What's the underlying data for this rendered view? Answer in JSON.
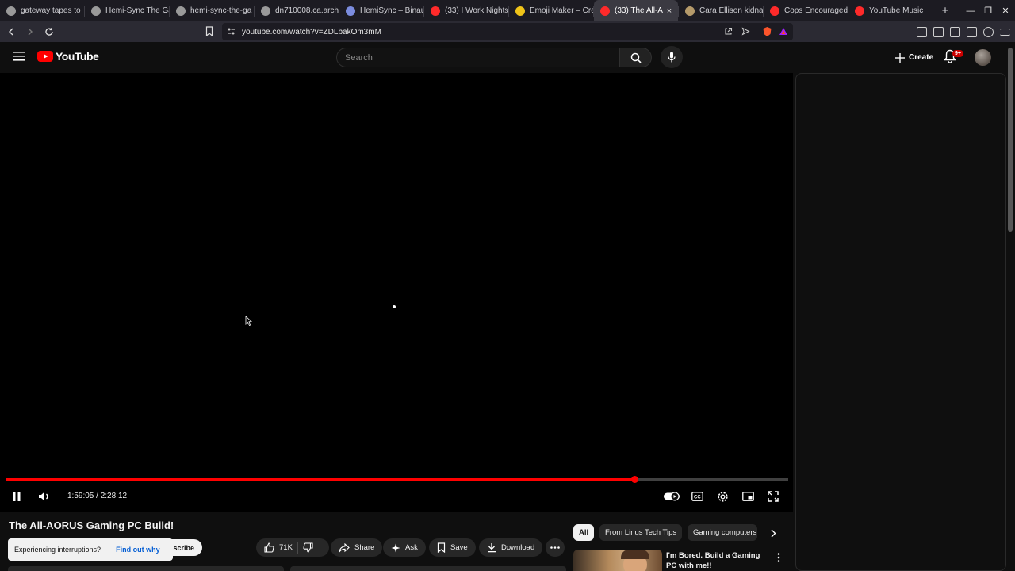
{
  "browser": {
    "tabs": [
      {
        "title": "gateway tapes to",
        "color": "#9a9a9a",
        "active": false
      },
      {
        "title": "Hemi-Sync The Ga",
        "color": "#9a9a9a",
        "active": false
      },
      {
        "title": "hemi-sync-the-ga",
        "color": "#9a9a9a",
        "active": false
      },
      {
        "title": "dn710008.ca.arch",
        "color": "#9a9a9a",
        "active": false
      },
      {
        "title": "HemiSync – Binau",
        "color": "#7b8cde",
        "active": false
      },
      {
        "title": "(33) I Work Nights",
        "color": "#ff2a2a",
        "active": false
      },
      {
        "title": "Emoji Maker – Cre",
        "color": "#f0c419",
        "active": false
      },
      {
        "title": "(33) The All-A",
        "color": "#ff2a2a",
        "active": true
      },
      {
        "title": "Cara Ellison kidna",
        "color": "#b59a6a",
        "active": false
      },
      {
        "title": "Cops Encouraged",
        "color": "#ff2a2a",
        "active": false
      },
      {
        "title": "YouTube Music",
        "color": "#ff2a2a",
        "active": false
      }
    ],
    "tab_close": "×",
    "new_tab": "+",
    "url": "youtube.com/watch?v=ZDLbakOm3mM"
  },
  "youtube": {
    "logo_text": "YouTube",
    "search_placeholder": "Search",
    "create_label": "Create",
    "notification_badge": "9+"
  },
  "player": {
    "current_time": "1:59:05",
    "duration": "2:28:12",
    "time_display": "1:59:05 / 2:28:12",
    "progress_fraction": 0.8037
  },
  "video": {
    "title": "The All-AORUS Gaming PC Build!",
    "subscribe_label": "scribe",
    "likes": "71K",
    "share_label": "Share",
    "ask_label": "Ask",
    "save_label": "Save",
    "download_label": "Download"
  },
  "toast": {
    "message": "Experiencing interruptions?",
    "link": "Find out why"
  },
  "chips": [
    "All",
    "From Linus Tech Tips",
    "Gaming computers"
  ],
  "recommendation": {
    "title": "I'm Bored. Build a Gaming PC with me!!"
  },
  "colors": {
    "accent_red": "#ff0000",
    "background": "#0f0f0f",
    "chip_bg": "#272727"
  }
}
